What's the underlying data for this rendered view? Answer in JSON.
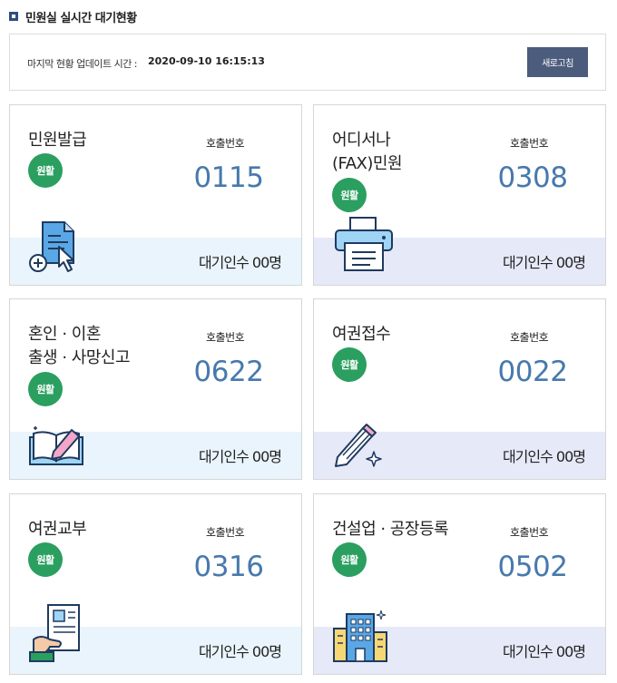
{
  "page": {
    "title": "민원실 실시간 대기현황",
    "update_label": "마지막 현황 업데이트 시간 :",
    "update_time": "2020-09-10 16:15:13",
    "refresh_label": "새로고침"
  },
  "cards": [
    {
      "name": "민원발급",
      "status": "원활",
      "call_label": "호출번호",
      "call_number": "0115",
      "wait": "대기인수 00명",
      "icon": "document-add-icon"
    },
    {
      "name": "어디서나\n(FAX)민원",
      "status": "원활",
      "call_label": "호출번호",
      "call_number": "0308",
      "wait": "대기인수 00명",
      "icon": "fax-machine-icon"
    },
    {
      "name": "혼인 · 이혼\n출생 · 사망신고",
      "status": "원활",
      "call_label": "호출번호",
      "call_number": "0622",
      "wait": "대기인수 00명",
      "icon": "open-book-pencil-icon"
    },
    {
      "name": "여권접수",
      "status": "원활",
      "call_label": "호출번호",
      "call_number": "0022",
      "wait": "대기인수 00명",
      "icon": "pencil-sparkle-icon"
    },
    {
      "name": "여권교부",
      "status": "원활",
      "call_label": "호출번호",
      "call_number": "0316",
      "wait": "대기인수 00명",
      "icon": "hand-holding-document-icon"
    },
    {
      "name": "건설업 · 공장등록",
      "status": "원활",
      "call_label": "호출번호",
      "call_number": "0502",
      "wait": "대기인수 00명",
      "icon": "building-icon"
    }
  ],
  "colors": {
    "accent_navy": "#2f4d82",
    "button_bg": "#4c5c7c",
    "status_green": "#2a9f5f",
    "number_blue": "#4779ad",
    "band_left": "#e9f4fc",
    "band_right": "#e6e9f8"
  }
}
